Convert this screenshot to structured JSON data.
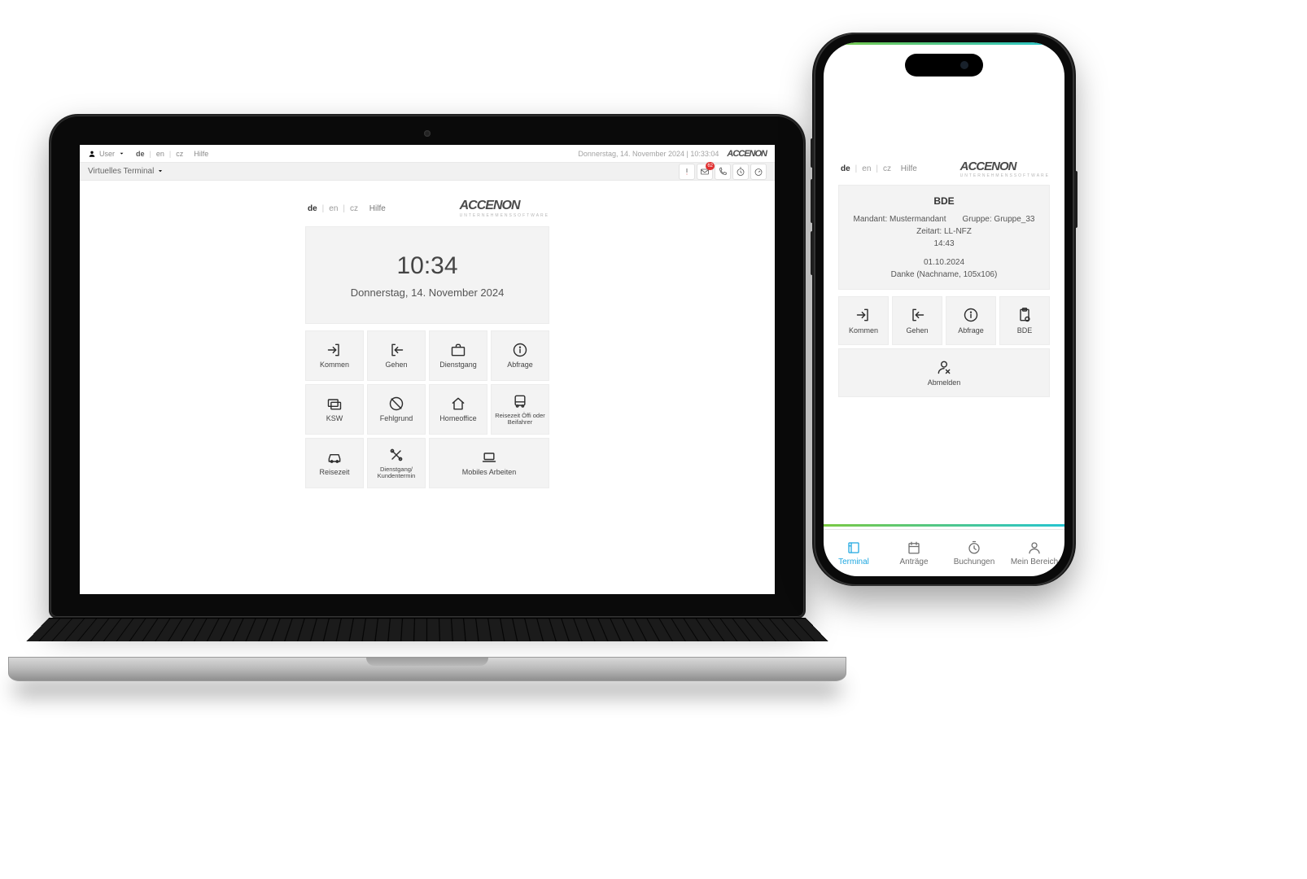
{
  "laptop": {
    "header1": {
      "user_label": "User",
      "langs": [
        "de",
        "en",
        "cz"
      ],
      "selected_lang": "de",
      "help": "Hilfe",
      "datetime": "Donnerstag, 14. November 2024 | 10:33:04"
    },
    "header2": {
      "title": "Virtuelles Terminal",
      "mail_badge": "62",
      "icons": [
        "alert",
        "mail",
        "phone",
        "stopwatch",
        "timer"
      ]
    },
    "terminal": {
      "langs": [
        "de",
        "en",
        "cz"
      ],
      "selected_lang": "de",
      "help": "Hilfe",
      "brand": "ACCENON",
      "brand_sub": "UNTERNEHMENSSOFTWARE",
      "time": "10:34",
      "date": "Donnerstag, 14. November 2024",
      "buttons": [
        {
          "id": "kommen",
          "label": "Kommen",
          "icon": "login"
        },
        {
          "id": "gehen",
          "label": "Gehen",
          "icon": "logout"
        },
        {
          "id": "dienstgang",
          "label": "Dienstgang",
          "icon": "briefcase"
        },
        {
          "id": "abfrage",
          "label": "Abfrage",
          "icon": "info"
        },
        {
          "id": "ksw",
          "label": "KSW",
          "icon": "cardswap"
        },
        {
          "id": "fehlgrund",
          "label": "Fehlgrund",
          "icon": "nocircle"
        },
        {
          "id": "homeoffice",
          "label": "Homeoffice",
          "icon": "home"
        },
        {
          "id": "reisezeit-offi",
          "label": "Reisezeit Öffi oder Beifahrer",
          "icon": "bus",
          "small": true
        },
        {
          "id": "reisezeit",
          "label": "Reisezeit",
          "icon": "car"
        },
        {
          "id": "dienstgang-kt",
          "label": "Dienstgang/ Kundentermin",
          "icon": "tools",
          "small": true
        },
        {
          "id": "mobiles",
          "label": "Mobiles Arbeiten",
          "icon": "laptop",
          "span": 2
        }
      ]
    }
  },
  "phone": {
    "langs": [
      "de",
      "en",
      "cz"
    ],
    "selected_lang": "de",
    "help": "Hilfe",
    "brand": "ACCENON",
    "brand_sub": "UNTERNEHMENSSOFTWARE",
    "info": {
      "title": "BDE",
      "mandant_label": "Mandant:",
      "mandant_value": "Mustermandant",
      "gruppe_label": "Gruppe:",
      "gruppe_value": "Gruppe_33",
      "zeitart_label": "Zeitart:",
      "zeitart_value": "LL-NFZ",
      "time": "14:43",
      "date": "01.10.2024",
      "thanks": "Danke (Nachname, 105x106)"
    },
    "buttons": [
      {
        "id": "kommen",
        "label": "Kommen",
        "icon": "login"
      },
      {
        "id": "gehen",
        "label": "Gehen",
        "icon": "logout"
      },
      {
        "id": "abfrage",
        "label": "Abfrage",
        "icon": "info"
      },
      {
        "id": "bde",
        "label": "BDE",
        "icon": "clipboard"
      },
      {
        "id": "abmelden",
        "label": "Abmelden",
        "icon": "userx",
        "full": true
      }
    ],
    "tabs": [
      {
        "id": "terminal",
        "label": "Terminal",
        "icon": "terminal",
        "active": true
      },
      {
        "id": "antraege",
        "label": "Anträge",
        "icon": "calendar"
      },
      {
        "id": "buchungen",
        "label": "Buchungen",
        "icon": "stopwatch"
      },
      {
        "id": "meinbereich",
        "label": "Mein Bereich",
        "icon": "user"
      }
    ]
  }
}
